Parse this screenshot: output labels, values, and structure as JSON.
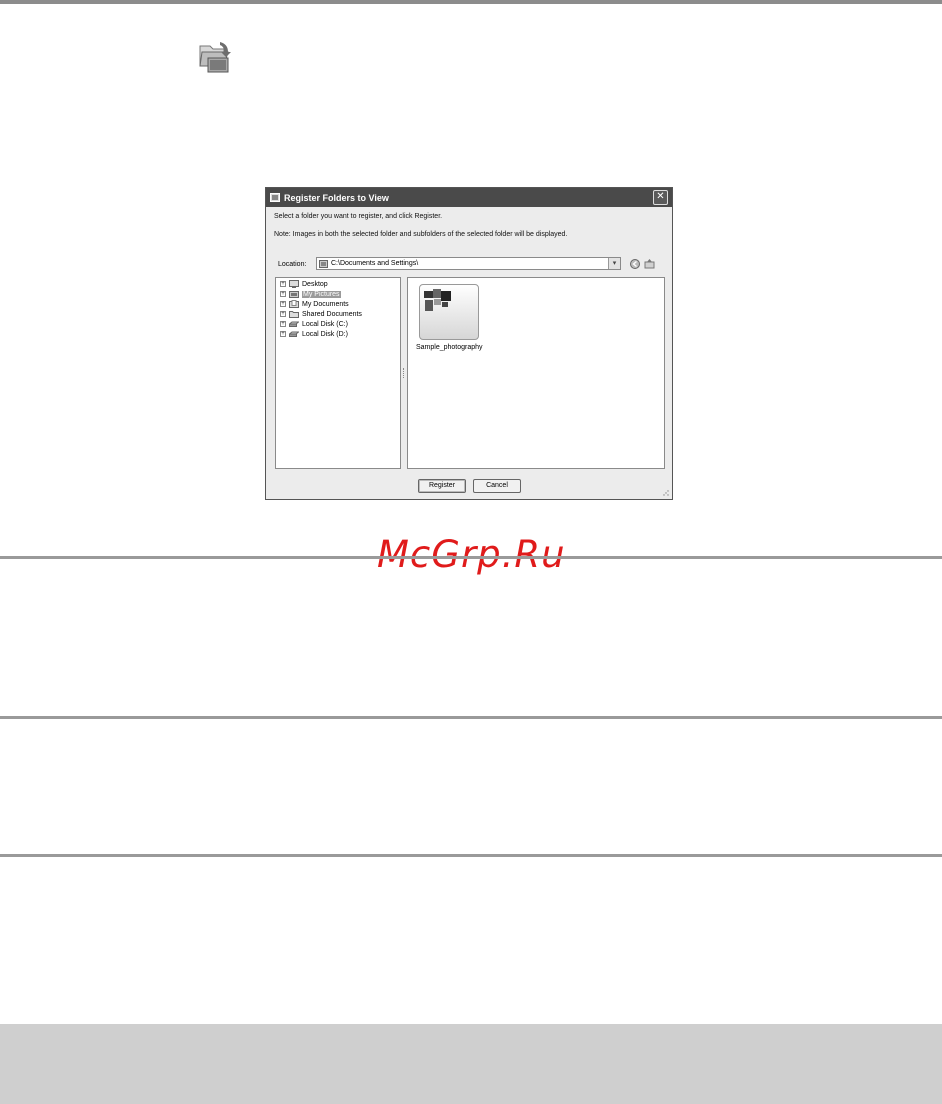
{
  "watermark": "McGrp.Ru",
  "dialog": {
    "title": "Register Folders to View",
    "close_label": "✕",
    "instruction": "Select a folder you want to register, and click Register.",
    "note": "Note: Images in both the selected folder and subfolders of the selected folder will be displayed.",
    "location_label": "Location:",
    "location_value": "C:\\Documents and Settings\\",
    "tree": [
      {
        "label": "Desktop",
        "icon": "desktop-icon",
        "selected": false
      },
      {
        "label": "My Pictures",
        "icon": "pictures-folder-icon",
        "selected": true
      },
      {
        "label": "My Documents",
        "icon": "documents-folder-icon",
        "selected": false
      },
      {
        "label": "Shared Documents",
        "icon": "folder-icon",
        "selected": false
      },
      {
        "label": "Local Disk (C:)",
        "icon": "disk-icon",
        "selected": false
      },
      {
        "label": "Local Disk (D:)",
        "icon": "disk-icon",
        "selected": false
      }
    ],
    "folder_item": "Sample_photography",
    "register_label": "Register",
    "cancel_label": "Cancel"
  }
}
